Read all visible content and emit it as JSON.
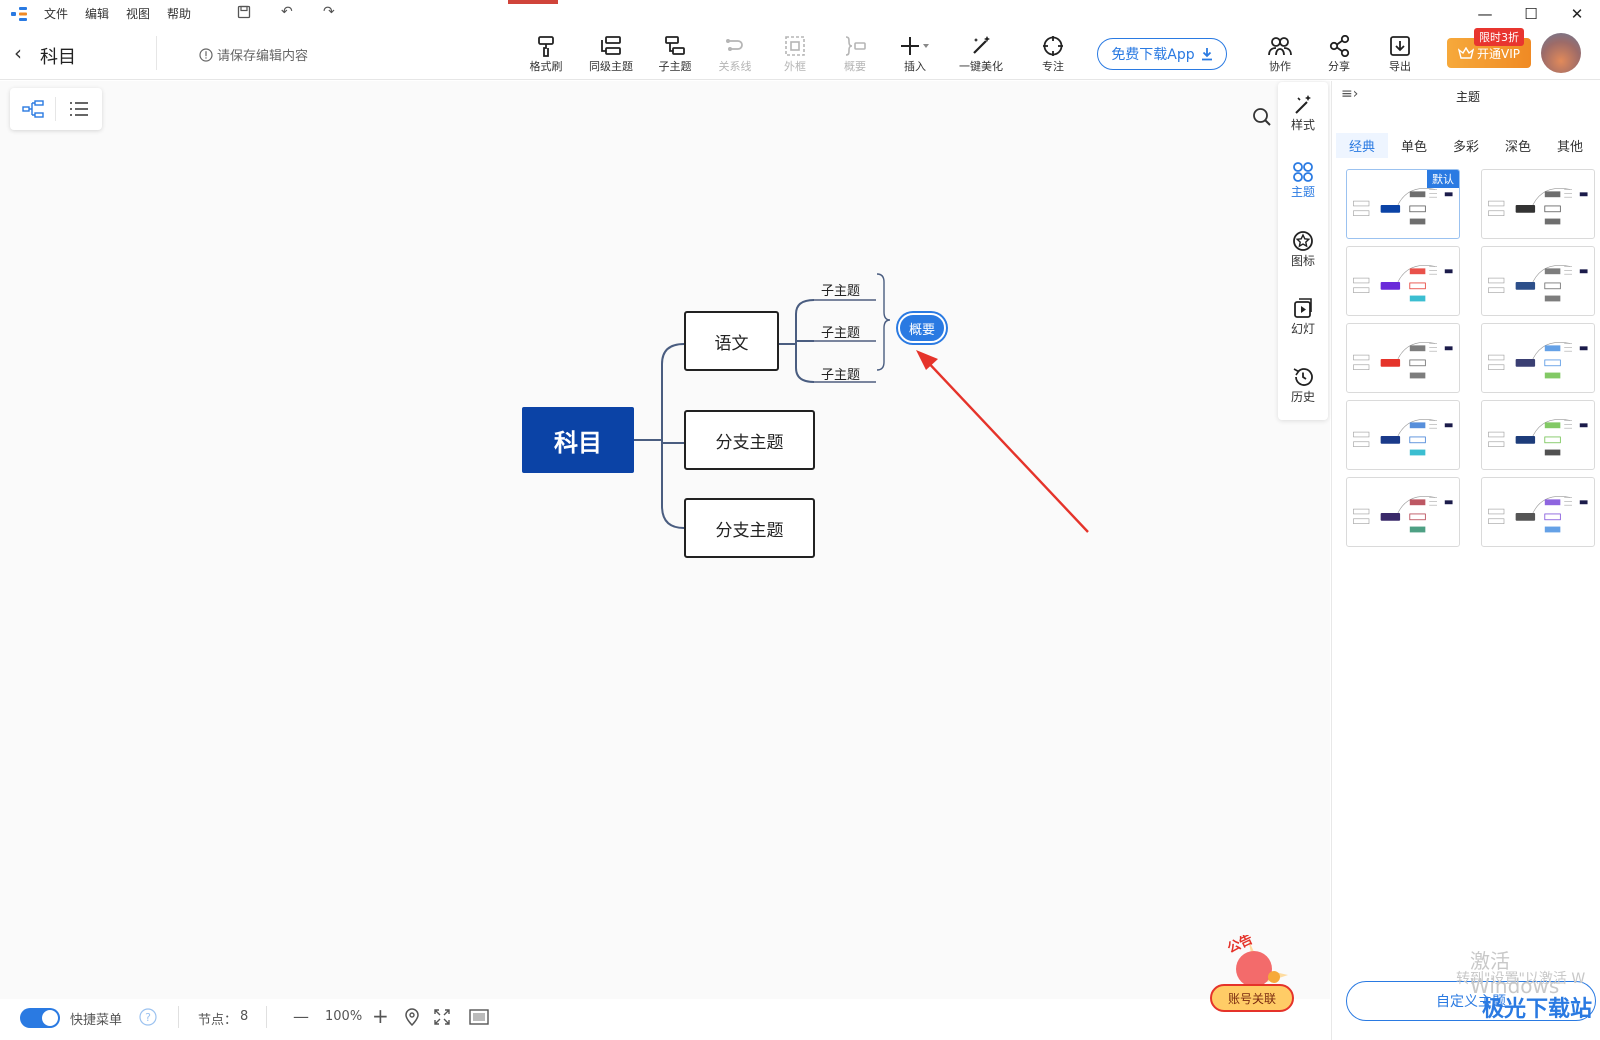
{
  "menu": [
    "文件",
    "编辑",
    "视图",
    "帮助"
  ],
  "header": {
    "doc_title": "科目",
    "save_hint": "请保存编辑内容"
  },
  "toolbar": {
    "tools": [
      {
        "label": "格式刷",
        "icon": "format-brush-icon",
        "enabled": true
      },
      {
        "label": "同级主题",
        "icon": "sibling-topic-icon",
        "enabled": true
      },
      {
        "label": "子主题",
        "icon": "child-topic-icon",
        "enabled": true
      },
      {
        "label": "关系线",
        "icon": "relation-line-icon",
        "enabled": false
      },
      {
        "label": "外框",
        "icon": "boundary-icon",
        "enabled": false
      },
      {
        "label": "概要",
        "icon": "summary-icon",
        "enabled": false
      },
      {
        "label": "插入",
        "icon": "plus-icon",
        "enabled": true
      },
      {
        "label": "一键美化",
        "icon": "magic-wand-icon",
        "enabled": true
      },
      {
        "label": "专注",
        "icon": "focus-icon",
        "enabled": true
      }
    ],
    "download_app": "免费下载App",
    "right_tools": [
      {
        "label": "协作",
        "icon": "collab-icon"
      },
      {
        "label": "分享",
        "icon": "share-icon"
      },
      {
        "label": "导出",
        "icon": "export-icon"
      }
    ],
    "vip_badge": "限时3折",
    "vip_label": "开通VIP"
  },
  "mindmap": {
    "root": "科目",
    "branches": [
      "语文",
      "分支主题",
      "分支主题"
    ],
    "subtopics": [
      "子主题",
      "子主题",
      "子主题"
    ],
    "summary": "概要"
  },
  "side_strip": [
    {
      "label": "样式",
      "icon": "style-icon",
      "active": false
    },
    {
      "label": "主题",
      "icon": "theme-icon",
      "active": true
    },
    {
      "label": "图标",
      "icon": "icon-icon",
      "active": false
    },
    {
      "label": "幻灯",
      "icon": "slides-icon",
      "active": false
    },
    {
      "label": "历史",
      "icon": "history-icon",
      "active": false
    }
  ],
  "panel": {
    "title": "主题",
    "tabs": [
      "经典",
      "单色",
      "多彩",
      "深色",
      "其他"
    ],
    "active_tab": "经典",
    "default_badge": "默认",
    "custom_theme": "自定义主题"
  },
  "bottom": {
    "quick_menu": "快捷菜单",
    "nodes_label": "节点：",
    "nodes_count": "8",
    "zoom": "100%",
    "account_link": "账号关联",
    "announcement": "公告"
  },
  "watermark": {
    "line1": "激活 Windows",
    "line2": "转到\"设置\"以激活 W",
    "site": "极光下载站"
  },
  "colors": {
    "accent": "#2a7ae2",
    "root": "#0b43a6",
    "arrow": "#e5332a"
  }
}
